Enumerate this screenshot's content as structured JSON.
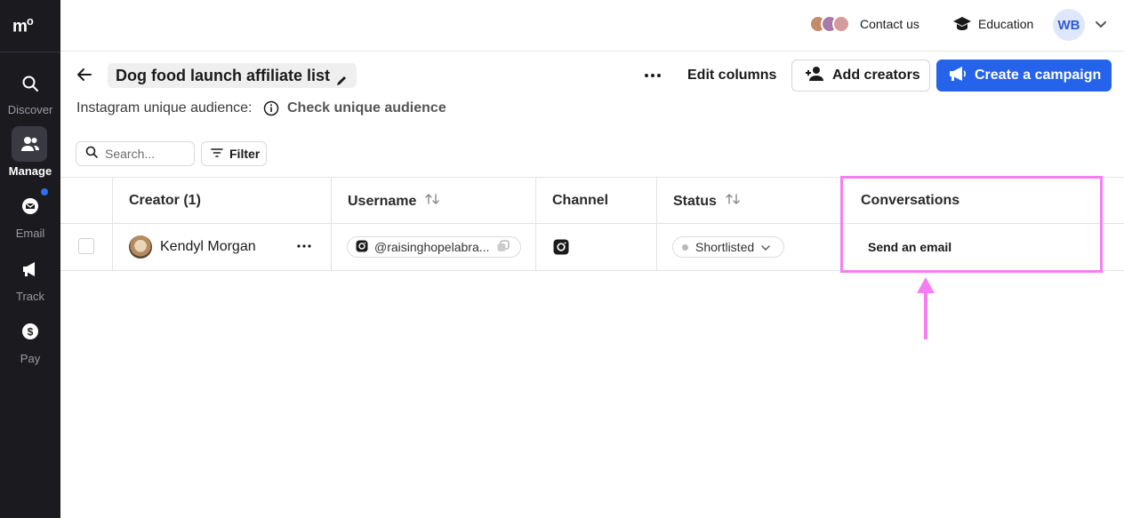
{
  "sidebar": {
    "logo": "m",
    "logo_sup": "o",
    "items": [
      {
        "label": "Discover",
        "icon": "search-icon"
      },
      {
        "label": "Manage",
        "icon": "people-icon",
        "active": true
      },
      {
        "label": "Email",
        "icon": "mail-icon",
        "badge": true
      },
      {
        "label": "Track",
        "icon": "megaphone-icon"
      },
      {
        "label": "Pay",
        "icon": "dollar-icon"
      }
    ]
  },
  "topbar": {
    "contact_label": "Contact us",
    "education_label": "Education",
    "user_initials": "WB"
  },
  "header": {
    "title": "Dog food launch affiliate list",
    "edit_columns_label": "Edit columns",
    "add_creators_label": "Add creators",
    "create_campaign_label": "Create a campaign",
    "audience_label": "Instagram unique audience:",
    "audience_link": "Check unique audience"
  },
  "toolbar": {
    "search_placeholder": "Search...",
    "filter_label": "Filter"
  },
  "table": {
    "columns": [
      "Creator (1)",
      "Username",
      "Channel",
      "Status",
      "Conversations"
    ],
    "rows": [
      {
        "creator": "Kendyl Morgan",
        "username": "@raisinghopelabra...",
        "channel": "instagram",
        "status": "Shortlisted",
        "conversation": "Send an email"
      }
    ]
  },
  "colors": {
    "sidebar_bg": "#1b1b1f",
    "primary": "#2563eb",
    "highlight": "#f77ef2"
  }
}
